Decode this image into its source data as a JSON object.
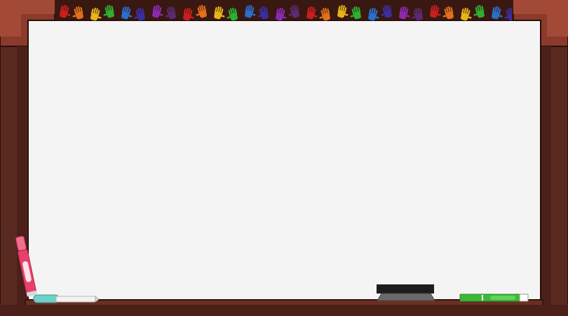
{
  "colors": {
    "board_surface": "#f4f4f4",
    "frame_dark": "#4a2019",
    "frame_mid": "#5a2a21",
    "frame_light": "#8b3a2c",
    "frame_top_highlight": "#a34a36",
    "frame_outline": "#2a0f0b"
  },
  "handprint_colors": [
    "#c81e1e",
    "#e0701a",
    "#e4b41a",
    "#2fae2f",
    "#2a6fc9",
    "#3a2ea0",
    "#8a2ab0",
    "#5b2a70"
  ],
  "items": [
    {
      "name": "pink-marker-icon",
      "color": "#e8406a",
      "cap_color": "#f06e8e"
    },
    {
      "name": "white-marker-icon",
      "color": "#f2f2f2",
      "cap_color": "#6fd0c8"
    },
    {
      "name": "eraser-icon",
      "color": "#1d1d1d",
      "base_color": "#6a6a6a"
    },
    {
      "name": "green-marker-icon",
      "color": "#3db83a",
      "cap_color": "#ffffff"
    }
  ]
}
